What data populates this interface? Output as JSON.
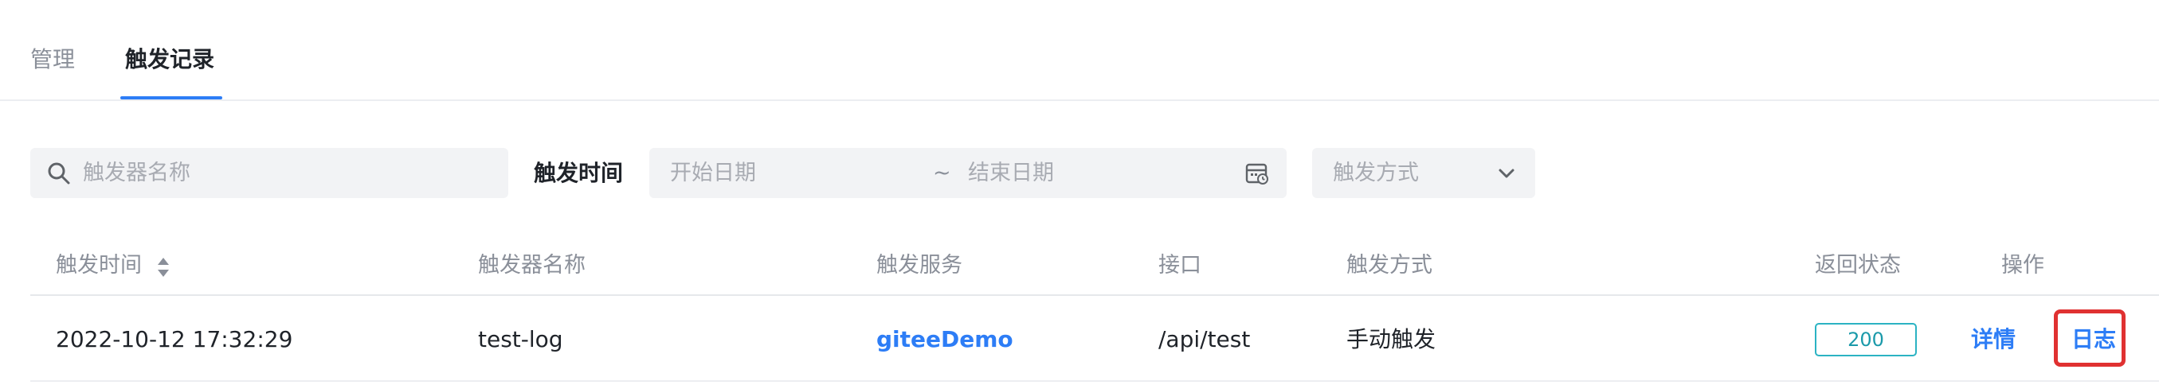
{
  "tabs": [
    {
      "label": "管理",
      "active": false
    },
    {
      "label": "触发记录",
      "active": true
    }
  ],
  "filters": {
    "search_placeholder": "触发器名称",
    "time_label": "触发时间",
    "start_date_placeholder": "开始日期",
    "date_separator": "~",
    "end_date_placeholder": "结束日期",
    "mode_placeholder": "触发方式"
  },
  "table": {
    "columns": [
      "触发时间",
      "触发器名称",
      "触发服务",
      "接口",
      "触发方式",
      "返回状态",
      "操作"
    ],
    "rows": [
      {
        "time": "2022-10-12 17:32:29",
        "trigger_name": "test-log",
        "service": "giteeDemo",
        "api": "/api/test",
        "mode": "手动触发",
        "status": "200",
        "actions": {
          "detail": "详情",
          "log": "日志"
        }
      }
    ]
  },
  "colors": {
    "accent": "#2d7df6",
    "status_badge": "#2bb3c3",
    "highlight": "#e03131"
  },
  "icons": [
    "search-icon",
    "calendar-icon",
    "chevron-down-icon",
    "sort-icon"
  ]
}
